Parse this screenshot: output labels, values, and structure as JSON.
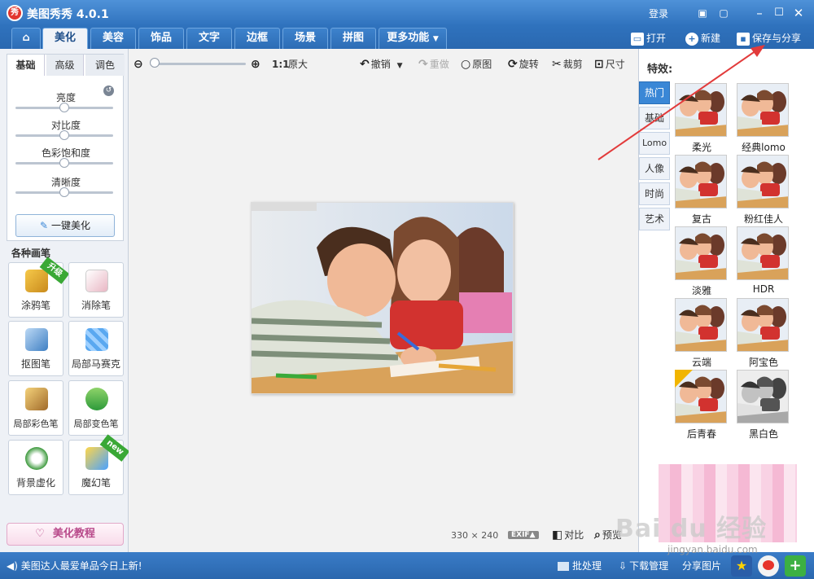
{
  "app": {
    "logo_char": "秀",
    "title": "美图秀秀 4.0.1",
    "login": "登录"
  },
  "tabs": [
    "美化",
    "美容",
    "饰品",
    "文字",
    "边框",
    "场景",
    "拼图",
    "更多功能"
  ],
  "toolbar": {
    "open": "打开",
    "new": "新建",
    "save_share": "保存与分享"
  },
  "adjust": {
    "subtabs": [
      "基础",
      "高级",
      "调色"
    ],
    "sliders": [
      {
        "label": "亮度",
        "value": 0.5
      },
      {
        "label": "对比度",
        "value": 0.5
      },
      {
        "label": "色彩饱和度",
        "value": 0.5
      },
      {
        "label": "清晰度",
        "value": 0.5
      }
    ],
    "one_click": "一键美化"
  },
  "pens": {
    "title": "各种画笔",
    "items": [
      {
        "label": "涂鸦笔",
        "tag": "升级"
      },
      {
        "label": "消除笔",
        "tag": ""
      },
      {
        "label": "抠图笔",
        "tag": ""
      },
      {
        "label": "局部马赛克",
        "tag": ""
      },
      {
        "label": "局部彩色笔",
        "tag": ""
      },
      {
        "label": "局部变色笔",
        "tag": ""
      },
      {
        "label": "背景虚化",
        "tag": ""
      },
      {
        "label": "魔幻笔",
        "tag": "new"
      }
    ],
    "tutorial": "美化教程"
  },
  "canvas": {
    "ratio": "1:1",
    "original_size": "原大",
    "undo": "撤销",
    "redo": "重做",
    "original": "原图",
    "rotate": "旋转",
    "crop": "裁剪",
    "resize": "尺寸",
    "width": "330",
    "times": "×",
    "height": "240",
    "exif": "EXIF▲",
    "compare": "对比",
    "preview": "预览"
  },
  "effects": {
    "title": "特效:",
    "categories": [
      "热门",
      "基础",
      "Lomo",
      "人像",
      "时尚",
      "艺术"
    ],
    "items": [
      "柔光",
      "经典lomo",
      "复古",
      "粉红佳人",
      "淡雅",
      "HDR",
      "云端",
      "阿宝色",
      "后青春",
      "黑白色"
    ]
  },
  "status": {
    "news": "美图达人最爱单品今日上新!",
    "batch": "批处理",
    "download": "下载管理",
    "share": "分享图片"
  },
  "watermark": {
    "brand": "Bai du 经验",
    "url": "jingyan.baidu.com"
  },
  "colors": {
    "accent": "#2f72bd",
    "active_tab": "#3a87d6",
    "tutorial": "#b8498a",
    "arrow": "#e23b3b"
  }
}
